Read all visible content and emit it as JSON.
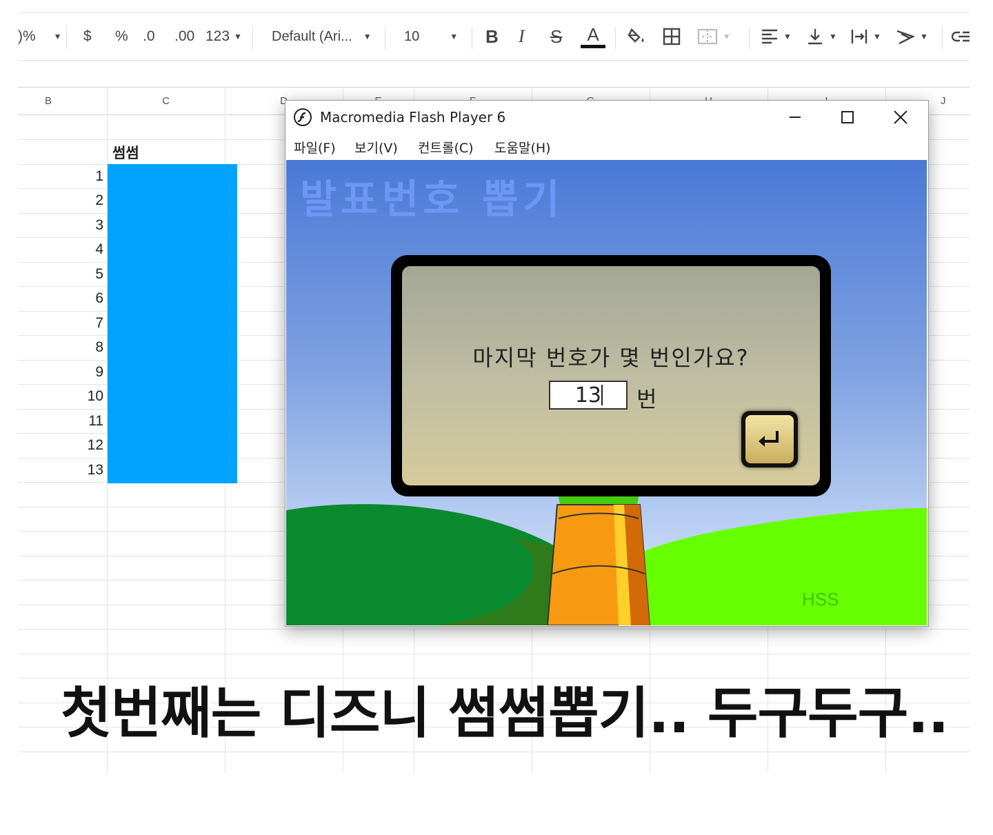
{
  "toolbar": {
    "percent_cut": ")%",
    "currency": "$",
    "percent": "%",
    "dec_decrease": ".0",
    "dec_increase": ".00",
    "more_formats": "123",
    "font_family": "Default (Ari...",
    "font_size": "10",
    "bold": "B",
    "italic": "I",
    "strike": "S",
    "text_color": "A",
    "link_cut": "G"
  },
  "sheet": {
    "columns": [
      "B",
      "C",
      "D",
      "E",
      "F",
      "G",
      "H",
      "I",
      "J"
    ],
    "header_cell": "썸썸",
    "rows": [
      "1",
      "2",
      "3",
      "4",
      "5",
      "6",
      "7",
      "8",
      "9",
      "10",
      "11",
      "12",
      "13"
    ],
    "highlight_color": "#00a3ff"
  },
  "flash_window": {
    "title": "Macromedia Flash Player 6",
    "menu": [
      "파일(F)",
      "보기(V)",
      "컨트롤(C)",
      "도움말(H)"
    ],
    "stage_title": "발표번호 뽑기",
    "question": "마지막 번호가 몇 번인가요?",
    "input_value": "13",
    "unit": "번",
    "watermark": "HSS"
  },
  "caption": "첫번째는 디즈니 썸썸뽑기.. 두구두구.."
}
